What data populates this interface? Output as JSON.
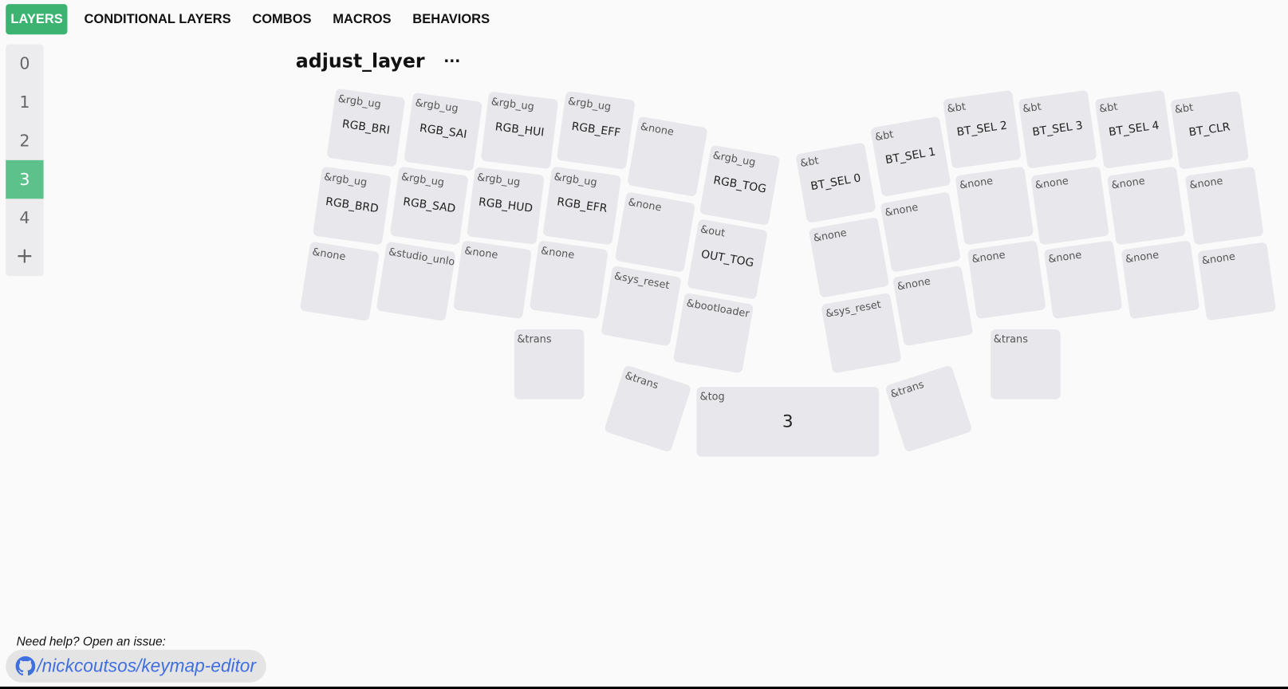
{
  "tabs": [
    "LAYERS",
    "CONDITIONAL LAYERS",
    "COMBOS",
    "MACROS",
    "BEHAVIORS"
  ],
  "active_tab": "LAYERS",
  "layers": [
    "0",
    "1",
    "2",
    "3",
    "4"
  ],
  "active_layer": "3",
  "add_layer": "+",
  "layer_title": "adjust_layer",
  "more_label": "···",
  "keys": [
    {
      "b": "&rgb_ug",
      "p": "RGB_BRI"
    },
    {
      "b": "&rgb_ug",
      "p": "RGB_SAI"
    },
    {
      "b": "&rgb_ug",
      "p": "RGB_HUI"
    },
    {
      "b": "&rgb_ug",
      "p": "RGB_EFF"
    },
    {
      "b": "&none",
      "p": ""
    },
    {
      "b": "&rgb_ug",
      "p": "RGB_TOG"
    },
    {
      "b": "&bt",
      "p": "BT_SEL 0"
    },
    {
      "b": "&bt",
      "p": "BT_SEL 1"
    },
    {
      "b": "&bt",
      "p": "BT_SEL 2"
    },
    {
      "b": "&bt",
      "p": "BT_SEL 3"
    },
    {
      "b": "&bt",
      "p": "BT_SEL 4"
    },
    {
      "b": "&bt",
      "p": "BT_CLR"
    },
    {
      "b": "&rgb_ug",
      "p": "RGB_BRD"
    },
    {
      "b": "&rgb_ug",
      "p": "RGB_SAD"
    },
    {
      "b": "&rgb_ug",
      "p": "RGB_HUD"
    },
    {
      "b": "&rgb_ug",
      "p": "RGB_EFR"
    },
    {
      "b": "&none",
      "p": ""
    },
    {
      "b": "&out",
      "p": "OUT_TOG"
    },
    {
      "b": "&none",
      "p": ""
    },
    {
      "b": "&none",
      "p": ""
    },
    {
      "b": "&none",
      "p": ""
    },
    {
      "b": "&none",
      "p": ""
    },
    {
      "b": "&none",
      "p": ""
    },
    {
      "b": "&none",
      "p": ""
    },
    {
      "b": "&none",
      "p": ""
    },
    {
      "b": "&studio_unlock",
      "p": ""
    },
    {
      "b": "&none",
      "p": ""
    },
    {
      "b": "&none",
      "p": ""
    },
    {
      "b": "&sys_reset",
      "p": ""
    },
    {
      "b": "&bootloader",
      "p": ""
    },
    {
      "b": "&sys_reset",
      "p": ""
    },
    {
      "b": "&none",
      "p": ""
    },
    {
      "b": "&none",
      "p": ""
    },
    {
      "b": "&none",
      "p": ""
    },
    {
      "b": "&none",
      "p": ""
    },
    {
      "b": "&none",
      "p": ""
    },
    {
      "b": "&trans",
      "p": ""
    },
    {
      "b": "&trans",
      "p": ""
    },
    {
      "b": "&tog",
      "p": "3"
    },
    {
      "b": "&trans",
      "p": ""
    },
    {
      "b": "&trans",
      "p": ""
    }
  ],
  "footer": {
    "help_text": "Need help? Open an issue:",
    "repo_link": "/nickcoutsos/keymap-editor"
  },
  "colors": {
    "accent": "#3cb371",
    "key_bg": "#e8e8ec",
    "link": "#3f6fe0"
  }
}
